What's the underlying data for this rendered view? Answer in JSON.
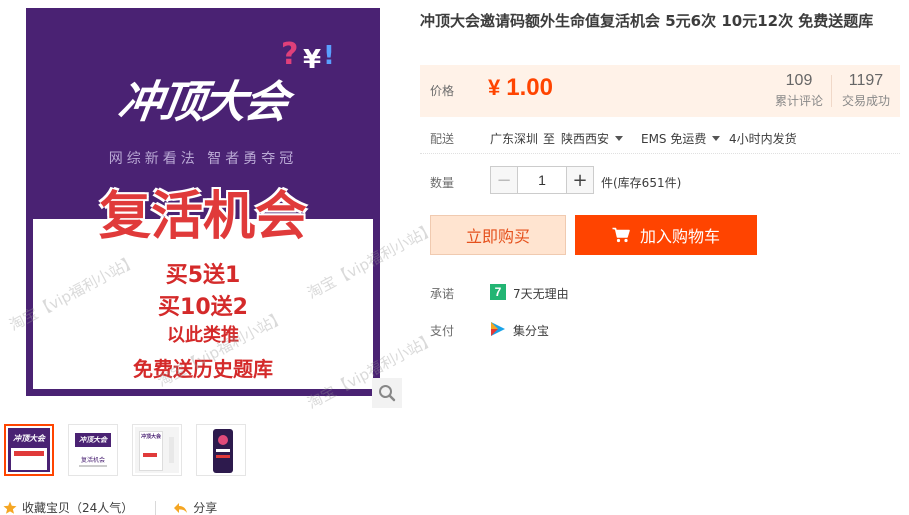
{
  "product": {
    "title": "冲顶大会邀请码额外生命值复活机会 5元6次 10元12次 免费送题库"
  },
  "gallery": {
    "brand_name": "冲顶大会",
    "slogan": "网综新看法 智者勇夺冠",
    "banner_title": "复活机会",
    "promo_lines": [
      "买5送1",
      "买10送2",
      "以此类推",
      "免费送历史题库"
    ],
    "watermark": "淘宝【vip福利小站】",
    "thumbnails": [
      {
        "label": "冲顶大会"
      },
      {
        "label": "复活机会"
      },
      {
        "label": "冲顶大会"
      },
      {
        "label": ""
      }
    ]
  },
  "price": {
    "label": "价格",
    "currency": "¥",
    "value": "1.00",
    "reviews_count": "109",
    "reviews_label": "累计评论",
    "sales_count": "1197",
    "sales_label": "交易成功"
  },
  "shipping": {
    "label": "配送",
    "from": "广东深圳",
    "to_word": "至",
    "destination": "陕西西安",
    "method": "EMS 免运费",
    "dispatch": "4小时内发货"
  },
  "quantity": {
    "label": "数量",
    "minus": "−",
    "value": "1",
    "plus": "+",
    "stock_text": "件(库存651件)"
  },
  "actions": {
    "buy_now": "立即购买",
    "add_to_cart": "加入购物车"
  },
  "promise": {
    "label": "承诺",
    "text": "7天无理由",
    "icon_char": "7"
  },
  "payment": {
    "label": "支付",
    "text": "集分宝"
  },
  "footer": {
    "favorite": "收藏宝贝（24人气）",
    "share": "分享"
  },
  "colors": {
    "accent": "#ff4400",
    "price": "#ff4400",
    "buy_bg": "#ffe4d0",
    "brand_purple": "#4a2273",
    "promise_green": "#22b573"
  }
}
